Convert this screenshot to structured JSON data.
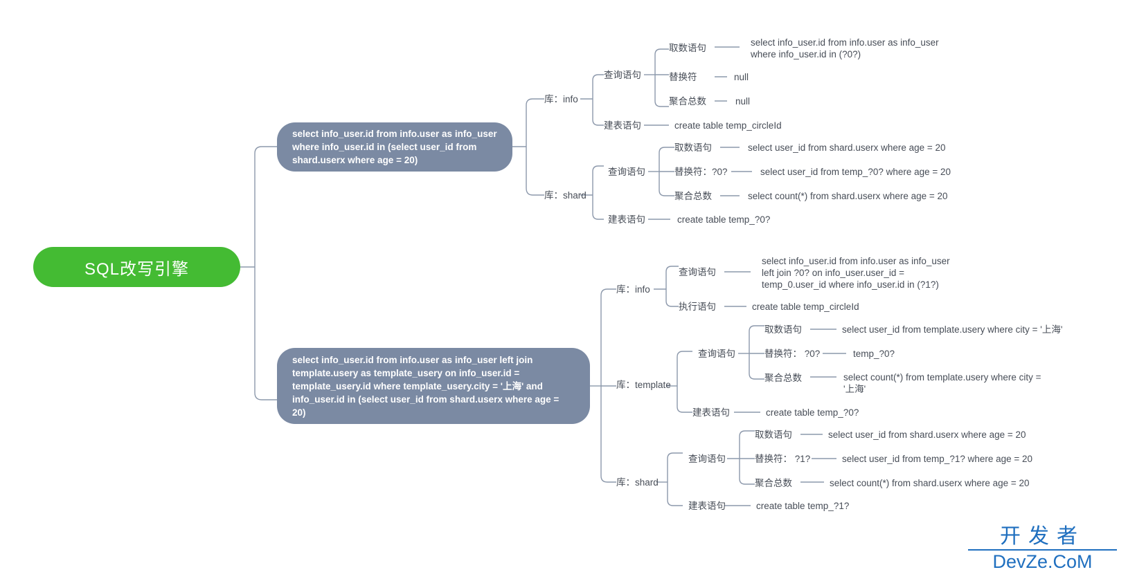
{
  "root": {
    "label": "SQL改写引擎",
    "color": "#44bb33"
  },
  "node_color": "#7b8aa3",
  "link_color": "#8c98ab",
  "text_color": "#474d57",
  "watermark": {
    "cn": "开发者",
    "en": "DevZe.CoM",
    "color": "#1f6fbf"
  },
  "branches": [
    {
      "statement": "select info_user.id from info.user as info_user where info_user.id in (select user_id from shard.userx where age = 20)",
      "databases": [
        {
          "name": "库：info",
          "groups": [
            {
              "label": "查询语句",
              "items": [
                {
                  "label": "取数语句",
                  "value": "select info_user.id from info.user as info_user where info_user.id in (?0?)"
                },
                {
                  "label": "替换符",
                  "value": "null"
                },
                {
                  "label": "聚合总数",
                  "value": "null"
                }
              ]
            }
          ],
          "leaves": [
            {
              "label": "建表语句",
              "value": "create table temp_circleId"
            }
          ]
        },
        {
          "name": "库：shard",
          "groups": [
            {
              "label": "查询语句",
              "items": [
                {
                  "label": "取数语句",
                  "value": "select user_id from shard.userx where age = 20"
                },
                {
                  "label": "替换符：?0?",
                  "value": "select user_id from temp_?0? where age = 20"
                },
                {
                  "label": "聚合总数",
                  "value": "select count(*) from shard.userx where age = 20"
                }
              ]
            }
          ],
          "leaves": [
            {
              "label": "建表语句",
              "value": "create table temp_?0?"
            }
          ]
        }
      ]
    },
    {
      "statement": "select info_user.id from info.user as info_user left join template.usery as template_usery on info_user.id = template_usery.id where template_usery.city = '上海' and info_user.id in (select user_id from shard.userx where age = 20)",
      "databases": [
        {
          "name": "库：info",
          "groups": [],
          "leaves": [
            {
              "label": "查询语句",
              "value": "select info_user.id from info.user as info_user left join ?0?  on info_user.user_id =  temp_0.user_id where info_user.id in (?1?)"
            },
            {
              "label": "执行语句",
              "value": "create table temp_circleId"
            }
          ]
        },
        {
          "name": "库：template",
          "groups": [
            {
              "label": "查询语句",
              "items": [
                {
                  "label": "取数语句",
                  "value": "select user_id from template.usery where city = '上海'"
                },
                {
                  "label": "替换符： ?0?",
                  "value": "temp_?0?"
                },
                {
                  "label": "聚合总数",
                  "value": "select count(*) from template.usery where city = '上海'"
                }
              ]
            }
          ],
          "leaves": [
            {
              "label": "建表语句",
              "value": "create table temp_?0?"
            }
          ]
        },
        {
          "name": "库：shard",
          "groups": [
            {
              "label": "查询语句",
              "items": [
                {
                  "label": "取数语句",
                  "value": "select user_id from shard.userx where age = 20"
                },
                {
                  "label": "替换符： ?1?",
                  "value": "select user_id from temp_?1? where age = 20"
                },
                {
                  "label": "聚合总数",
                  "value": "select count(*) from shard.userx where age = 20"
                }
              ]
            }
          ],
          "leaves": [
            {
              "label": "建表语句",
              "value": "create table temp_?1?"
            }
          ]
        }
      ]
    }
  ]
}
